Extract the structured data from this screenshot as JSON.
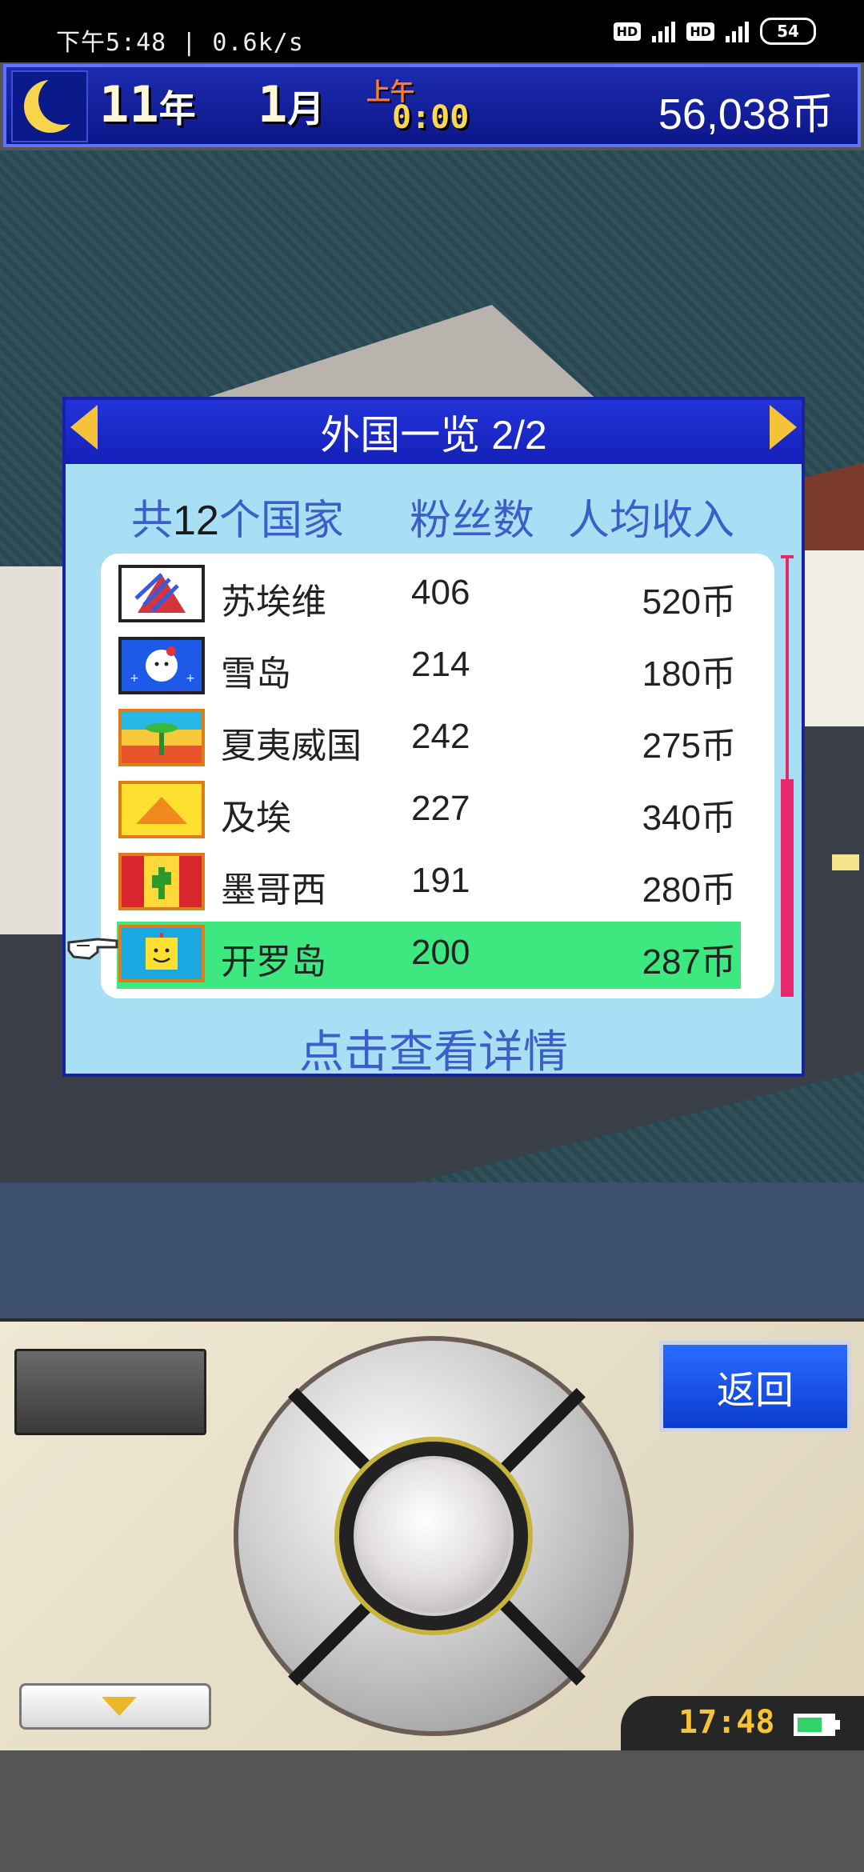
{
  "status_bar": {
    "time": "下午5:48 | 0.6k/s",
    "hd1": "HD",
    "hd2": "HD",
    "battery": "54"
  },
  "top_bar": {
    "year_num": "11",
    "year_unit": "年",
    "month_num": "1",
    "month_unit": "月",
    "ampm": "上午",
    "clock": "0:00",
    "money": "56,038币"
  },
  "dialog": {
    "title": "外国一览 2/2",
    "header": {
      "count_prefix": "共",
      "count_num": "12",
      "count_suffix": "个国家",
      "fans_label": "粉丝数",
      "income_label": "人均收入"
    },
    "rows": [
      {
        "name": "苏埃维",
        "fans": "406",
        "income": "520币"
      },
      {
        "name": "雪岛",
        "fans": "214",
        "income": "180币"
      },
      {
        "name": "夏夷威国",
        "fans": "242",
        "income": "275币"
      },
      {
        "name": "及埃",
        "fans": "227",
        "income": "340币"
      },
      {
        "name": "墨哥西",
        "fans": "191",
        "income": "280币"
      },
      {
        "name": "开罗岛",
        "fans": "200",
        "income": "287币"
      }
    ],
    "details": "点击查看详情"
  },
  "controller": {
    "back_label": "返回",
    "clock": "17:48"
  }
}
